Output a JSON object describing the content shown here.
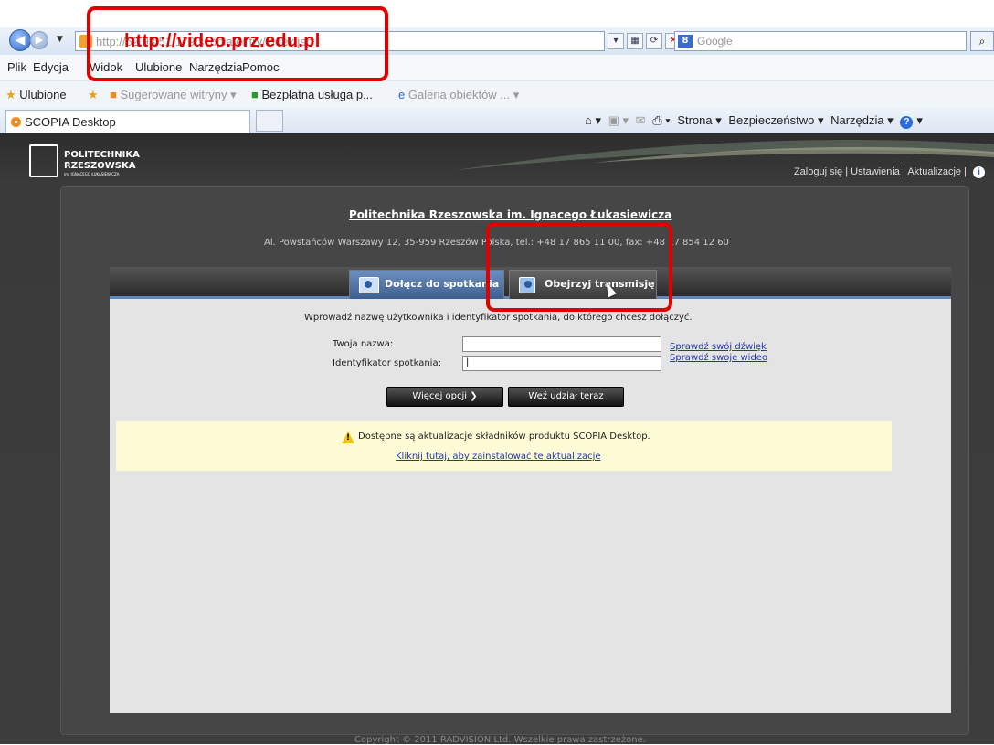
{
  "browser": {
    "url": "http://62.93.51.179/scopia/entry/index.jsp",
    "search_placeholder": "Google",
    "search_logo": "8",
    "menu": [
      "Plik",
      "Edycja",
      "Widok",
      "Ulubione",
      "Narzędzia",
      "Pomoc"
    ],
    "favorites": {
      "label": "Ulubione",
      "items": [
        "Sugerowane witryny ▾",
        "Bezpłatna usługa p...",
        "Galeria obiektów ... ▾"
      ]
    },
    "tab_title": "SCOPIA Desktop",
    "commands": [
      "Strona ▾",
      "Bezpieczeństwo ▾",
      "Narzędzia ▾"
    ],
    "help_glyph": "?"
  },
  "header": {
    "logo_line1": "POLITECHNIKA",
    "logo_line2": "RZESZOWSKA",
    "logo_line3": "im. IGNACEGO ŁUKASIEWICZA",
    "links": [
      "Zaloguj się",
      "Ustawienia",
      "Aktualizacje"
    ],
    "separator": "|",
    "info_glyph": "i"
  },
  "org": {
    "name": "Politechnika Rzeszowska im. Ignacego Łukasiewicza",
    "address": "Al. Powstańców Warszawy 12, 35-959 Rzeszów Polska, tel.: +48 17 865 11 00, fax: +48 17 854 12 60"
  },
  "tabs": {
    "join": "Dołącz do spotkania",
    "watch": "Obejrzyj transmisję"
  },
  "form": {
    "prompt": "Wprowadź nazwę użytkownika i identyfikator spotkania, do którego chcesz dołączyć.",
    "name_label": "Twoja nazwa:",
    "meeting_label": "Identyfikator spotkania:",
    "name_value": "",
    "meeting_value": "|",
    "sound_link": "Sprawdź swój dźwięk",
    "video_link": "Sprawdź swoje wideo",
    "more_button": "Więcej opcji ❯",
    "join_button": "Weź udział teraz"
  },
  "update": {
    "text": "Dostępne są aktualizacje składników produktu SCOPIA Desktop.",
    "link": "Kliknij tutaj, aby zainstalować te aktualizacje"
  },
  "footer": {
    "copyright": "Copyright © 2011 RADVISION Ltd. Wszelkie prawa zastrzeżone."
  },
  "annotation": {
    "url_text": "http://video.prz.edu.pl",
    "color": "#e00000"
  }
}
